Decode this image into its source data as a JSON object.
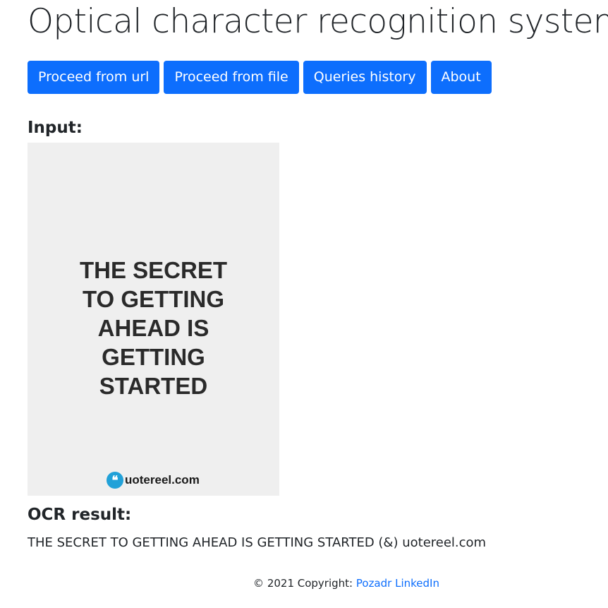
{
  "header": {
    "title": "Optical character recognition system"
  },
  "nav": {
    "buttons": [
      "Proceed from url",
      "Proceed from file",
      "Queries history",
      "About"
    ]
  },
  "input_section": {
    "heading": "Input:",
    "image_text": "THE SECRET\nTO GETTING\nAHEAD IS\nGETTING\nSTARTED",
    "watermark": {
      "icon": "quote-icon",
      "icon_glyph": "❝",
      "brand": "uotereel.com"
    }
  },
  "ocr_section": {
    "heading": "OCR result:",
    "result": "THE SECRET TO GETTING AHEAD IS GETTING STARTED (&) uotereel.com"
  },
  "footer": {
    "copyright": "© 2021 Copyright: ",
    "link_text": "Pozadr LinkedIn"
  },
  "colors": {
    "primary": "#0d6efd",
    "watermark_accent": "#21a1d8",
    "image_background": "#efefef"
  }
}
